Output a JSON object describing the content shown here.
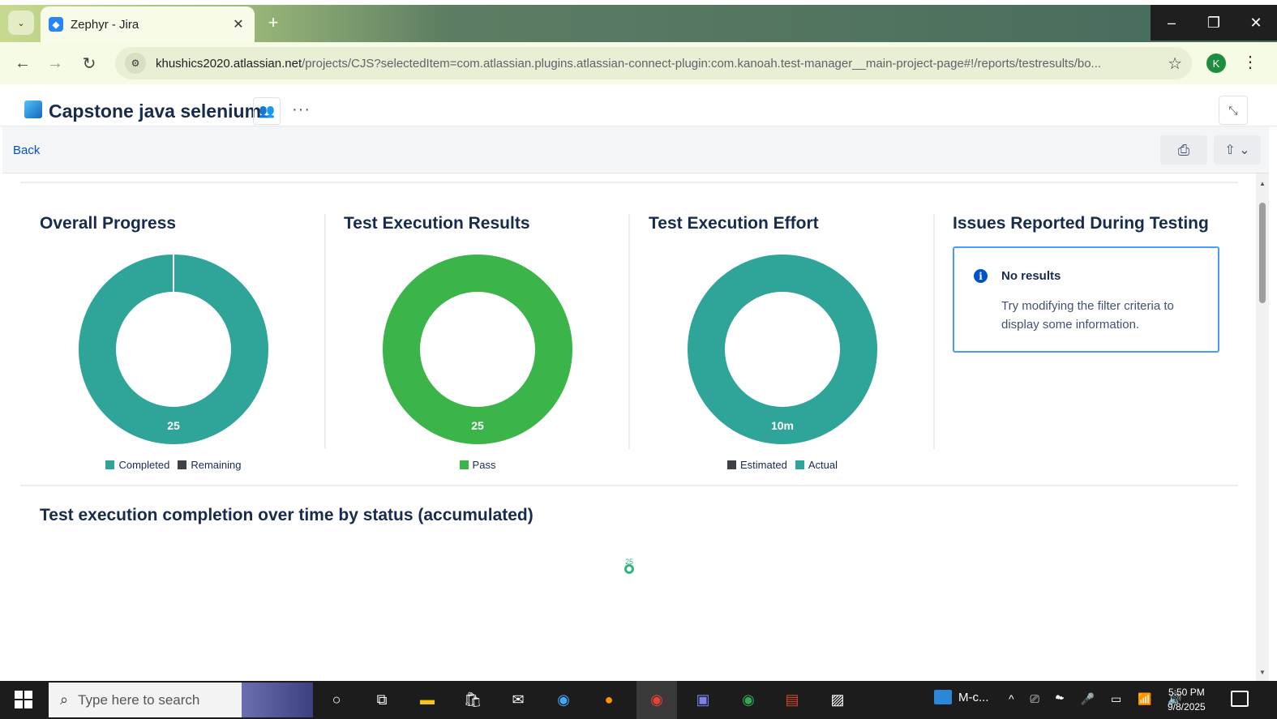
{
  "browser": {
    "tab_title": "Zephyr - Jira",
    "url_domain": "khushics2020.atlassian.net",
    "url_path": "/projects/CJS?selectedItem=com.atlassian.plugins.atlassian-connect-plugin:com.kanoah.test-manager__main-project-page#!/reports/testresults/bo...",
    "profile_initial": "K",
    "window_controls": [
      "–",
      "❐",
      "✕"
    ]
  },
  "project": {
    "title": "Capstone java selenium"
  },
  "toolbar": {
    "back_label": "Back"
  },
  "panels": [
    {
      "title": "Overall Progress",
      "center_label": "25",
      "legend": [
        {
          "label": "Completed",
          "color": "#2fa59a"
        },
        {
          "label": "Remaining",
          "color": "#3d4047"
        }
      ]
    },
    {
      "title": "Test Execution Results",
      "center_label": "25",
      "legend": [
        {
          "label": "Pass",
          "color": "#3bb54a"
        }
      ]
    },
    {
      "title": "Test Execution Effort",
      "center_label": "10m",
      "legend": [
        {
          "label": "Estimated",
          "color": "#3d4047"
        },
        {
          "label": "Actual",
          "color": "#2fa59a"
        }
      ]
    },
    {
      "title": "Issues Reported During Testing"
    }
  ],
  "no_results": {
    "title": "No results",
    "body": "Try modifying the filter criteria to display some information."
  },
  "section": {
    "title": "Test execution completion over time by status (accumulated)",
    "point_label": "25"
  },
  "chart_data": [
    {
      "type": "pie",
      "title": "Overall Progress",
      "categories": [
        "Completed",
        "Remaining"
      ],
      "values": [
        25,
        0
      ],
      "colors": [
        "#2fa59a",
        "#3d4047"
      ]
    },
    {
      "type": "pie",
      "title": "Test Execution Results",
      "categories": [
        "Pass"
      ],
      "values": [
        25
      ],
      "colors": [
        "#3bb54a"
      ]
    },
    {
      "type": "pie",
      "title": "Test Execution Effort",
      "categories": [
        "Estimated",
        "Actual"
      ],
      "values": [
        0,
        10
      ],
      "colors": [
        "#3d4047",
        "#2fa59a"
      ]
    }
  ],
  "taskbar": {
    "search_placeholder": "Type here to search",
    "tray_app_label": "M-c...",
    "time": "5:50 PM",
    "date": "9/8/2025"
  }
}
